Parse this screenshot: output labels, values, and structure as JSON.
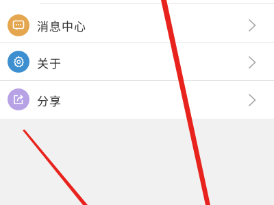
{
  "menu": {
    "items": [
      {
        "label": "消息中心",
        "icon": "message-icon",
        "icon_color": "#E4A64E"
      },
      {
        "label": "关于",
        "icon": "gear-icon",
        "icon_color": "#3D8FD0"
      },
      {
        "label": "分享",
        "icon": "share-icon",
        "icon_color": "#B7A2E6"
      }
    ]
  },
  "annotation": {
    "stroke_color": "#E8231E"
  }
}
